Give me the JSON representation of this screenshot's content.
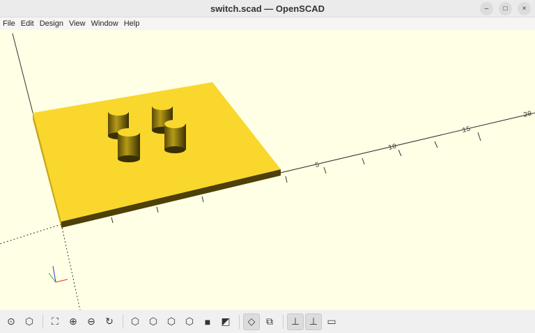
{
  "window": {
    "title": "switch.scad — OpenSCAD",
    "minimize": "–",
    "maximize": "□",
    "close": "×"
  },
  "menu": [
    "File",
    "Edit",
    "Design",
    "View",
    "Window",
    "Help"
  ],
  "viewport": {
    "axis_labels": [
      "5",
      "10",
      "15",
      "20"
    ],
    "colors": {
      "background": "#ffffe5",
      "model": "#f9d72c",
      "model_side": "#4d4008"
    }
  },
  "toolbar": [
    {
      "name": "preview",
      "icon": "⊙"
    },
    {
      "name": "render",
      "icon": "⬡"
    },
    {
      "name": "view-all",
      "icon": "⛶"
    },
    {
      "name": "zoom-in",
      "icon": "⊕"
    },
    {
      "name": "zoom-out",
      "icon": "⊖"
    },
    {
      "name": "reset-view",
      "icon": "↻"
    },
    {
      "name": "view-right",
      "icon": "⬡"
    },
    {
      "name": "view-top",
      "icon": "⬡"
    },
    {
      "name": "view-bottom",
      "icon": "⬡"
    },
    {
      "name": "view-left",
      "icon": "⬡"
    },
    {
      "name": "view-front",
      "icon": "■"
    },
    {
      "name": "view-back",
      "icon": "◩"
    },
    {
      "name": "perspective",
      "icon": "◇"
    },
    {
      "name": "orthogonal",
      "icon": "⧉"
    },
    {
      "name": "show-axes",
      "icon": "⊥"
    },
    {
      "name": "show-scale",
      "icon": "⊥"
    },
    {
      "name": "show-edges",
      "icon": "▭"
    }
  ]
}
